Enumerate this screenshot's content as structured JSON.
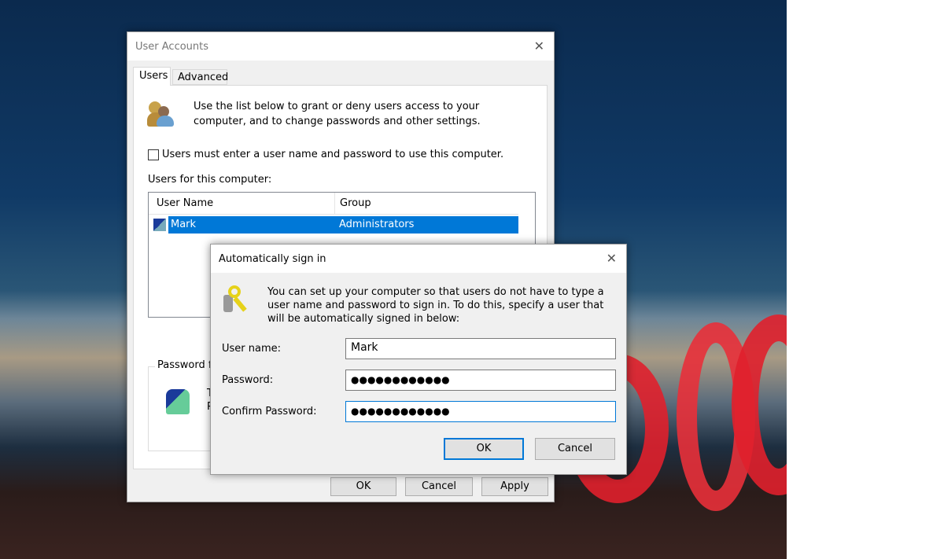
{
  "main_dialog": {
    "title": "User Accounts",
    "tabs": [
      {
        "label": "Users",
        "active": true
      },
      {
        "label": "Advanced",
        "active": false
      }
    ],
    "intro": "Use the list below to grant or deny users access to your computer, and to change passwords and other settings.",
    "require_login_label": "Users must enter a user name and password to use this computer.",
    "require_login_checked": false,
    "users_label": "Users for this computer:",
    "columns": [
      "User Name",
      "Group"
    ],
    "rows": [
      {
        "user": "Mark",
        "group": "Administrators",
        "selected": true
      }
    ],
    "password_group_label": "Password f",
    "password_text_lines": [
      "T",
      "P"
    ],
    "buttons": {
      "ok": "OK",
      "cancel": "Cancel",
      "apply": "Apply"
    }
  },
  "signin_dialog": {
    "title": "Automatically sign in",
    "description": "You can set up your computer so that users do not have to type a user name and password to sign in. To do this, specify a user that will be automatically signed in below:",
    "user_name_label": "User name:",
    "user_name_value": "Mark",
    "password_label": "Password:",
    "password_value": "●●●●●●●●●●●●",
    "confirm_label": "Confirm Password:",
    "confirm_value": "●●●●●●●●●●●●",
    "ok": "OK",
    "cancel": "Cancel"
  },
  "colors": {
    "selection": "#0078d7",
    "focus": "#0078d7"
  }
}
